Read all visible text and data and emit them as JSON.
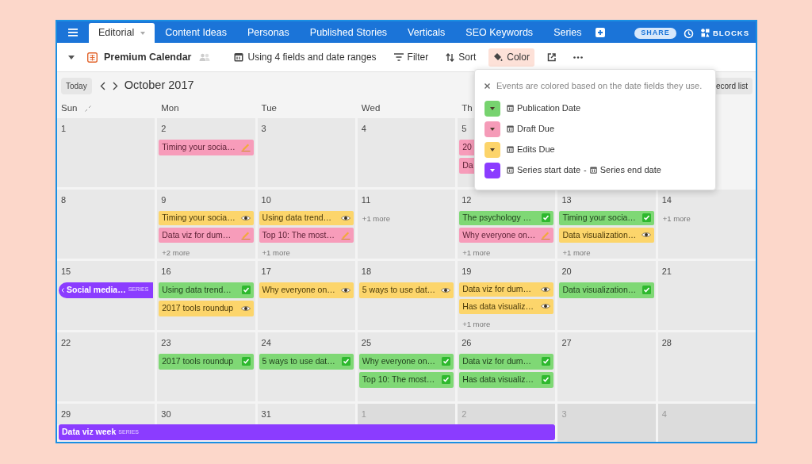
{
  "header": {
    "tabs": [
      {
        "label": "Editorial",
        "selected": true
      },
      {
        "label": "Content Ideas",
        "selected": false
      },
      {
        "label": "Personas",
        "selected": false
      },
      {
        "label": "Published Stories",
        "selected": false
      },
      {
        "label": "Verticals",
        "selected": false
      },
      {
        "label": "SEO Keywords",
        "selected": false
      },
      {
        "label": "Series",
        "selected": false
      }
    ],
    "share": "SHARE",
    "blocks": "BLOCKS"
  },
  "toolbar": {
    "view_name": "Premium Calendar",
    "items": [
      {
        "kind": "fields",
        "label": "Using 4 fields and date ranges",
        "selected": false
      },
      {
        "kind": "filter",
        "label": "Filter",
        "selected": false
      },
      {
        "kind": "sort",
        "label": "Sort",
        "selected": false
      },
      {
        "kind": "color",
        "label": "Color",
        "selected": true
      }
    ]
  },
  "calendar": {
    "today": "Today",
    "month": "October 2017",
    "record_list": "ecord list",
    "weekdays": [
      "Sun",
      "Mon",
      "Tue",
      "Wed",
      "Th"
    ],
    "weeks": [
      {
        "days": [
          {
            "date": "1",
            "muted": false
          },
          {
            "date": "2",
            "muted": false,
            "events": [
              {
                "kind": "draft",
                "title": "Timing your socia…"
              }
            ]
          },
          {
            "date": "3",
            "muted": false
          },
          {
            "date": "4",
            "muted": false
          },
          {
            "date": "5",
            "muted": false,
            "events": [
              {
                "kind": "draft",
                "title": "20"
              },
              {
                "kind": "draft",
                "title": "Da"
              }
            ]
          }
        ]
      },
      {
        "days": [
          {
            "date": "8",
            "muted": false
          },
          {
            "date": "9",
            "muted": false,
            "events": [
              {
                "kind": "edits",
                "title": "Timing your socia…"
              },
              {
                "kind": "draft",
                "title": "Data viz for dum…"
              }
            ],
            "more": "+2 more"
          },
          {
            "date": "10",
            "muted": false,
            "events": [
              {
                "kind": "edits",
                "title": "Using data trend…"
              },
              {
                "kind": "draft",
                "title": "Top 10: The most…"
              }
            ],
            "more": "+1 more"
          },
          {
            "date": "11",
            "muted": false,
            "more": "+1 more"
          },
          {
            "date": "12",
            "muted": false,
            "events": [
              {
                "kind": "published",
                "title": "The psychology …"
              },
              {
                "kind": "draft",
                "title": "Why everyone on…"
              }
            ],
            "more": "+1 more"
          },
          {
            "date": "13",
            "muted": false,
            "events": [
              {
                "kind": "published",
                "title": "Timing your socia…"
              },
              {
                "kind": "edits",
                "title": "Data visualization…"
              }
            ],
            "more": "+1 more"
          },
          {
            "date": "14",
            "muted": false,
            "more": "+1 more"
          }
        ]
      },
      {
        "days": [
          {
            "date": "15",
            "muted": false,
            "events": [
              {
                "kind": "series",
                "title": "Social media…",
                "tag": "SERIES",
                "continued": true
              }
            ]
          },
          {
            "date": "16",
            "muted": false,
            "events": [
              {
                "kind": "published",
                "title": "Using data trend…"
              },
              {
                "kind": "edits",
                "title": "2017 tools roundup"
              }
            ]
          },
          {
            "date": "17",
            "muted": false,
            "events": [
              {
                "kind": "edits",
                "title": "Why everyone on…"
              }
            ]
          },
          {
            "date": "18",
            "muted": false,
            "events": [
              {
                "kind": "edits",
                "title": "5 ways to use dat…"
              }
            ]
          },
          {
            "date": "19",
            "muted": false,
            "events": [
              {
                "kind": "edits",
                "title": "Data viz for dum…"
              },
              {
                "kind": "edits",
                "title": "Has data visualiz…"
              }
            ],
            "more": "+1 more"
          },
          {
            "date": "20",
            "muted": false,
            "events": [
              {
                "kind": "published",
                "title": "Data visualization…"
              }
            ]
          },
          {
            "date": "21",
            "muted": false
          }
        ]
      },
      {
        "days": [
          {
            "date": "22",
            "muted": false
          },
          {
            "date": "23",
            "muted": false,
            "events": [
              {
                "kind": "published",
                "title": "2017 tools roundup"
              }
            ]
          },
          {
            "date": "24",
            "muted": false,
            "events": [
              {
                "kind": "published",
                "title": "5 ways to use dat…"
              }
            ]
          },
          {
            "date": "25",
            "muted": false,
            "events": [
              {
                "kind": "published",
                "title": "Why everyone on…"
              },
              {
                "kind": "published",
                "title": "Top 10: The most…"
              }
            ]
          },
          {
            "date": "26",
            "muted": false,
            "events": [
              {
                "kind": "published",
                "title": "Data viz for dum…"
              },
              {
                "kind": "published",
                "title": "Has data visualiz…"
              }
            ]
          },
          {
            "date": "27",
            "muted": false
          },
          {
            "date": "28",
            "muted": false
          }
        ]
      },
      {
        "days": [
          {
            "date": "29",
            "muted": false,
            "in_series": true
          },
          {
            "date": "30",
            "muted": false,
            "in_series": true
          },
          {
            "date": "31",
            "muted": false,
            "in_series": true
          },
          {
            "date": "1",
            "muted": true,
            "in_series": true
          },
          {
            "date": "2",
            "muted": true,
            "in_series": true
          },
          {
            "date": "3",
            "muted": true,
            "in_series": false
          },
          {
            "date": "4",
            "muted": true,
            "in_series": false
          }
        ],
        "series_bar": {
          "kind": "series",
          "title": "Data viz week",
          "tag": "SERIES"
        }
      }
    ]
  },
  "color_popup": {
    "description": "Events are colored based on the date fields they use.",
    "items": [
      {
        "color": "#77d36f",
        "fields": [
          "Publication Date"
        ]
      },
      {
        "color": "#f59bb8",
        "fields": [
          "Draft Due"
        ]
      },
      {
        "color": "#fcd46a",
        "fields": [
          "Edits Due"
        ]
      },
      {
        "color": "#8b3cff",
        "fields": [
          "Series start date",
          "Series end date"
        ],
        "separator": "-"
      }
    ]
  }
}
